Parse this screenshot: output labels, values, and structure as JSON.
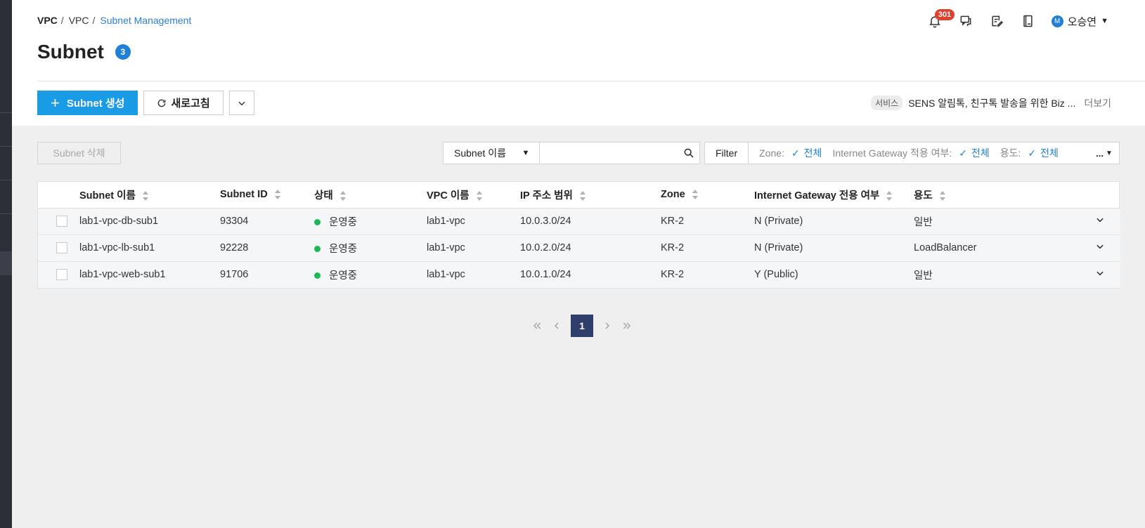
{
  "breadcrumb": {
    "root": "VPC",
    "parent": "VPC",
    "current": "Subnet Management"
  },
  "page": {
    "title": "Subnet",
    "count": "3"
  },
  "header": {
    "notification_count": "301",
    "user_initial": "M",
    "user_name": "오승연"
  },
  "actions": {
    "create_label": "Subnet 생성",
    "refresh_label": "새로고침"
  },
  "notice": {
    "tag": "서비스",
    "text": "SENS 알림톡, 친구톡 발송을 위한 Biz ...",
    "more": "더보기"
  },
  "toolbar": {
    "delete_label": "Subnet 삭제",
    "search_field": "Subnet 이름",
    "search_value": "",
    "filter_label": "Filter",
    "filters": [
      {
        "key": "Zone:",
        "value": "전체"
      },
      {
        "key": "Internet Gateway 적용 여부:",
        "value": "전체"
      },
      {
        "key": "용도:",
        "value": "전체"
      }
    ],
    "filter_more": "..."
  },
  "table": {
    "columns": [
      "Subnet 이름",
      "Subnet ID",
      "상태",
      "VPC 이름",
      "IP 주소 범위",
      "Zone",
      "Internet Gateway 전용 여부",
      "용도"
    ],
    "rows": [
      {
        "name": "lab1-vpc-db-sub1",
        "id": "93304",
        "status": "운영중",
        "vpc": "lab1-vpc",
        "ip": "10.0.3.0/24",
        "zone": "KR-2",
        "igw": "N (Private)",
        "usage": "일반"
      },
      {
        "name": "lab1-vpc-lb-sub1",
        "id": "92228",
        "status": "운영중",
        "vpc": "lab1-vpc",
        "ip": "10.0.2.0/24",
        "zone": "KR-2",
        "igw": "N (Private)",
        "usage": "LoadBalancer"
      },
      {
        "name": "lab1-vpc-web-sub1",
        "id": "91706",
        "status": "운영중",
        "vpc": "lab1-vpc",
        "ip": "10.0.1.0/24",
        "zone": "KR-2",
        "igw": "Y (Public)",
        "usage": "일반"
      }
    ]
  },
  "pagination": {
    "current": "1"
  },
  "colors": {
    "primary": "#1a9be6",
    "link": "#2d7fd3",
    "status_ok": "#1db954",
    "badge_red": "#e0412f",
    "page_current": "#2f3e6b",
    "rail": "#2b2f38"
  },
  "icons": [
    "bell-icon",
    "chat-icon",
    "memo-icon",
    "book-icon",
    "plus-icon",
    "refresh-icon",
    "chevron-down-icon",
    "search-icon",
    "check-icon",
    "sort-icon",
    "first-page-icon",
    "prev-page-icon",
    "next-page-icon",
    "last-page-icon"
  ]
}
